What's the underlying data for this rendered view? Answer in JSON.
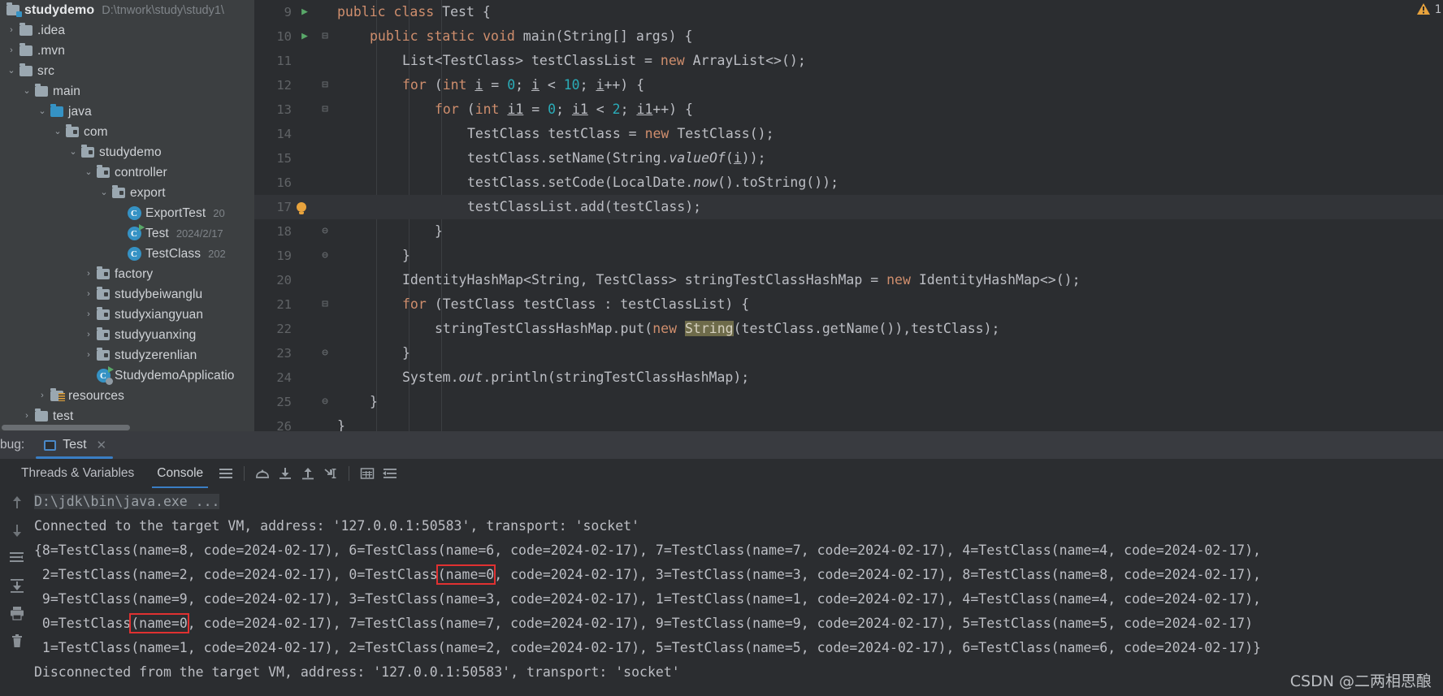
{
  "project": {
    "root_label": "studydemo",
    "root_path": "D:\\tnwork\\study\\study1\\",
    "items": [
      {
        "label": ".idea",
        "arrow": "›",
        "icon": "folder-icon",
        "depth": 0
      },
      {
        "label": ".mvn",
        "arrow": "›",
        "icon": "folder-icon",
        "depth": 0
      },
      {
        "label": "src",
        "arrow": "⌄",
        "icon": "folder-icon",
        "depth": 0
      },
      {
        "label": "main",
        "arrow": "⌄",
        "icon": "folder-icon",
        "depth": 1
      },
      {
        "label": "java",
        "arrow": "⌄",
        "icon": "source-folder-icon",
        "depth": 2
      },
      {
        "label": "com",
        "arrow": "⌄",
        "icon": "package-icon",
        "depth": 3
      },
      {
        "label": "studydemo",
        "arrow": "⌄",
        "icon": "package-icon",
        "depth": 4
      },
      {
        "label": "controller",
        "arrow": "⌄",
        "icon": "package-icon",
        "depth": 5
      },
      {
        "label": "export",
        "arrow": "⌄",
        "icon": "package-icon",
        "depth": 6
      },
      {
        "label": "ExportTest",
        "arrow": "",
        "icon": "java-class-icon",
        "depth": 7,
        "meta": "20"
      },
      {
        "label": "Test",
        "arrow": "",
        "icon": "java-runnable-class-icon",
        "depth": 7,
        "meta": "2024/2/17"
      },
      {
        "label": "TestClass",
        "arrow": "",
        "icon": "java-class-icon",
        "depth": 7,
        "meta": "202"
      },
      {
        "label": "factory",
        "arrow": "›",
        "icon": "package-icon",
        "depth": 5
      },
      {
        "label": "studybeiwanglu",
        "arrow": "›",
        "icon": "package-icon",
        "depth": 5
      },
      {
        "label": "studyxiangyuan",
        "arrow": "›",
        "icon": "package-icon",
        "depth": 5
      },
      {
        "label": "studyyuanxing",
        "arrow": "›",
        "icon": "package-icon",
        "depth": 5
      },
      {
        "label": "studyzerenlian",
        "arrow": "›",
        "icon": "package-icon",
        "depth": 5
      },
      {
        "label": "StudydemoApplicatio",
        "arrow": "",
        "icon": "spring-boot-class-icon",
        "depth": 5
      },
      {
        "label": "resources",
        "arrow": "›",
        "icon": "resources-folder-icon",
        "depth": 2
      },
      {
        "label": "test",
        "arrow": "›",
        "icon": "folder-icon",
        "depth": 1
      }
    ]
  },
  "editor": {
    "warning_count": "1",
    "lines": [
      {
        "num": "9",
        "run": true,
        "fold": "",
        "bulb": false,
        "indent": 0,
        "text": "public class Test {"
      },
      {
        "num": "10",
        "run": true,
        "fold": "⊟",
        "bulb": false,
        "indent": 1,
        "text": "public static void main(String[] args) {"
      },
      {
        "num": "11",
        "run": false,
        "fold": "",
        "bulb": false,
        "indent": 2,
        "text": "List<TestClass> testClassList = new ArrayList<>();"
      },
      {
        "num": "12",
        "run": false,
        "fold": "⊟",
        "bulb": false,
        "indent": 2,
        "text": "for (int i = 0; i < 10; i++) {"
      },
      {
        "num": "13",
        "run": false,
        "fold": "⊟",
        "bulb": false,
        "indent": 3,
        "text": "for (int i1 = 0; i1 < 2; i1++) {"
      },
      {
        "num": "14",
        "run": false,
        "fold": "",
        "bulb": false,
        "indent": 4,
        "text": "TestClass testClass = new TestClass();"
      },
      {
        "num": "15",
        "run": false,
        "fold": "",
        "bulb": false,
        "indent": 4,
        "text": "testClass.setName(String.valueOf(i));"
      },
      {
        "num": "16",
        "run": false,
        "fold": "",
        "bulb": false,
        "indent": 4,
        "text": "testClass.setCode(LocalDate.now().toString());"
      },
      {
        "num": "17",
        "run": false,
        "fold": "",
        "bulb": true,
        "indent": 4,
        "text": "testClassList.add(testClass);"
      },
      {
        "num": "18",
        "run": false,
        "fold": "⊖",
        "bulb": false,
        "indent": 3,
        "text": "}"
      },
      {
        "num": "19",
        "run": false,
        "fold": "⊖",
        "bulb": false,
        "indent": 2,
        "text": "}"
      },
      {
        "num": "20",
        "run": false,
        "fold": "",
        "bulb": false,
        "indent": 2,
        "text": "IdentityHashMap<String, TestClass> stringTestClassHashMap = new IdentityHashMap<>();"
      },
      {
        "num": "21",
        "run": false,
        "fold": "⊟",
        "bulb": false,
        "indent": 2,
        "text": "for (TestClass testClass : testClassList) {"
      },
      {
        "num": "22",
        "run": false,
        "fold": "",
        "bulb": false,
        "indent": 3,
        "text": "stringTestClassHashMap.put(new String(testClass.getName()),testClass);"
      },
      {
        "num": "23",
        "run": false,
        "fold": "⊖",
        "bulb": false,
        "indent": 2,
        "text": "}"
      },
      {
        "num": "24",
        "run": false,
        "fold": "",
        "bulb": false,
        "indent": 2,
        "text": "System.out.println(stringTestClassHashMap);"
      },
      {
        "num": "25",
        "run": false,
        "fold": "⊖",
        "bulb": false,
        "indent": 1,
        "text": "}"
      },
      {
        "num": "26",
        "run": false,
        "fold": "",
        "bulb": false,
        "indent": 0,
        "text": "}"
      }
    ]
  },
  "debug": {
    "panel_label": "bug:",
    "tab_label": "Test",
    "tab_close": "✕",
    "subtabs": [
      {
        "label": "Threads & Variables",
        "active": false
      },
      {
        "label": "Console",
        "active": true
      }
    ],
    "toolbar_icons": [
      "list-icon",
      "step-over-icon",
      "step-into-icon",
      "step-out-icon",
      "run-to-cursor-icon",
      "table-icon",
      "soft-wrap-icon"
    ],
    "side_icons": [
      "arrow-up-icon",
      "arrow-down-icon",
      "wrap-text-icon",
      "scroll-to-end-icon",
      "print-icon",
      "trash-icon"
    ]
  },
  "console": {
    "command_line": "D:\\jdk\\bin\\java.exe ...",
    "lines": [
      "Connected to the target VM, address: '127.0.0.1:50583', transport: 'socket'",
      "{8=TestClass(name=8, code=2024-02-17), 6=TestClass(name=6, code=2024-02-17), 7=TestClass(name=7, code=2024-02-17), 4=TestClass(name=4, code=2024-02-17),",
      " 2=TestClass(name=2, code=2024-02-17), 0=TestClass(name=0, code=2024-02-17), 3=TestClass(name=3, code=2024-02-17), 8=TestClass(name=8, code=2024-02-17),",
      " 9=TestClass(name=9, code=2024-02-17), 3=TestClass(name=3, code=2024-02-17), 1=TestClass(name=1, code=2024-02-17), 4=TestClass(name=4, code=2024-02-17),",
      " 0=TestClass(name=0, code=2024-02-17), 7=TestClass(name=7, code=2024-02-17), 9=TestClass(name=9, code=2024-02-17), 5=TestClass(name=5, code=2024-02-17)",
      " 1=TestClass(name=1, code=2024-02-17), 2=TestClass(name=2, code=2024-02-17), 5=TestClass(name=5, code=2024-02-17), 6=TestClass(name=6, code=2024-02-17)}",
      "Disconnected from the target VM, address: '127.0.0.1:50583', transport: 'socket'"
    ],
    "highlights": [
      {
        "line_index": 2,
        "text": "(name=0"
      },
      {
        "line_index": 4,
        "text": "(name=0"
      }
    ]
  },
  "watermark": "CSDN @二两相思酿",
  "colors": {
    "background": "#2b2d30",
    "tree_background": "#3c3f41",
    "accent_blue": "#3a7ec4",
    "keyword_orange": "#cf8e6d",
    "number_cyan": "#2aacb8",
    "text": "#bcbec4",
    "highlight_red": "#e03131",
    "string_highlight": "#6e6b4a"
  }
}
